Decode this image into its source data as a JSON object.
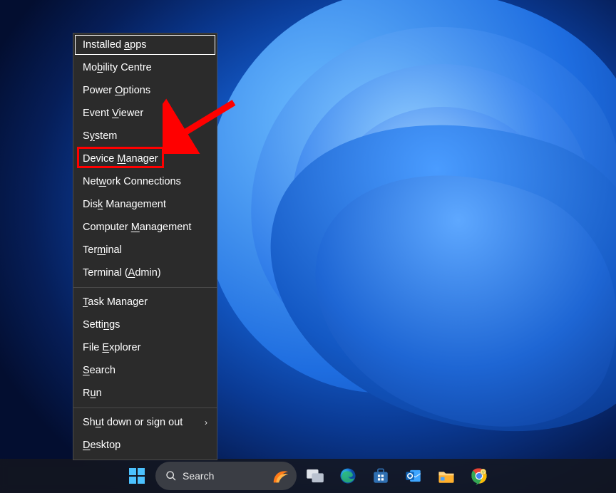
{
  "menu": {
    "groups": [
      [
        {
          "label": "Installed apps",
          "accelIndex": 10,
          "selected": true,
          "submenu": false
        },
        {
          "label": "Mobility Centre",
          "accelIndex": 2,
          "submenu": false
        },
        {
          "label": "Power Options",
          "accelIndex": 6,
          "submenu": false
        },
        {
          "label": "Event Viewer",
          "accelIndex": 6,
          "submenu": false
        },
        {
          "label": "System",
          "accelIndex": 1,
          "submenu": false
        },
        {
          "label": "Device Manager",
          "accelIndex": 7,
          "highlighted": true,
          "submenu": false
        },
        {
          "label": "Network Connections",
          "accelIndex": 3,
          "submenu": false
        },
        {
          "label": "Disk Management",
          "accelIndex": 3,
          "submenu": false
        },
        {
          "label": "Computer Management",
          "accelIndex": 9,
          "submenu": false
        },
        {
          "label": "Terminal",
          "accelIndex": 3,
          "submenu": false
        },
        {
          "label": "Terminal (Admin)",
          "accelIndex": 10,
          "submenu": false
        }
      ],
      [
        {
          "label": "Task Manager",
          "accelIndex": 0,
          "submenu": false
        },
        {
          "label": "Settings",
          "accelIndex": 5,
          "submenu": false
        },
        {
          "label": "File Explorer",
          "accelIndex": 5,
          "submenu": false
        },
        {
          "label": "Search",
          "accelIndex": 0,
          "submenu": false
        },
        {
          "label": "Run",
          "accelIndex": 1,
          "submenu": false
        }
      ],
      [
        {
          "label": "Shut down or sign out",
          "accelIndex": 2,
          "submenu": true
        },
        {
          "label": "Desktop",
          "accelIndex": 0,
          "submenu": false
        }
      ]
    ]
  },
  "taskbar": {
    "search_placeholder": "Search",
    "icons": [
      "start",
      "search",
      "task-view",
      "edge",
      "microsoft-store",
      "outlook",
      "file-explorer",
      "chrome"
    ]
  },
  "annotation": {
    "arrow_target": "Device Manager"
  }
}
